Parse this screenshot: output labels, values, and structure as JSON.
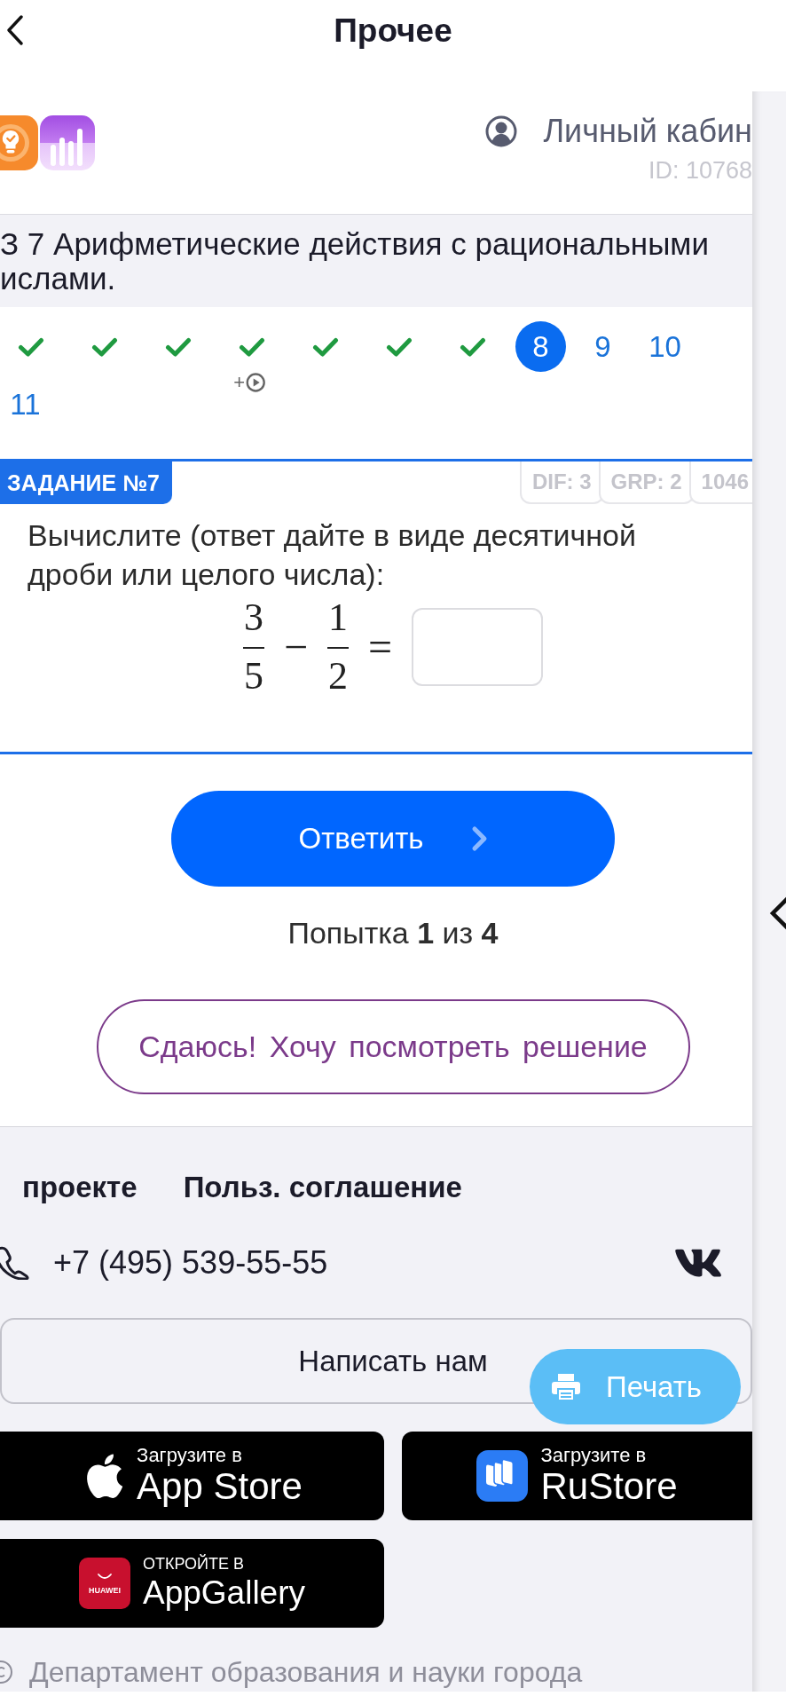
{
  "header": {
    "title": "Прочее"
  },
  "account": {
    "label": "Личный кабин",
    "id": "ID: 10768"
  },
  "lesson": {
    "title": "З 7 Арифметические действия с рациональными\nислами."
  },
  "steps": [
    {
      "done": true,
      "selected": false
    },
    {
      "done": true,
      "selected": false
    },
    {
      "done": true,
      "selected": false
    },
    {
      "done": true,
      "selected": false,
      "bonus": "+"
    },
    {
      "done": true,
      "selected": false
    },
    {
      "done": true,
      "selected": false
    },
    {
      "done": true,
      "selected": false
    },
    {
      "label": "8",
      "done": false,
      "selected": true
    },
    {
      "label": "9",
      "done": false,
      "selected": false
    },
    {
      "label": "10",
      "done": false,
      "selected": false
    },
    {
      "label": "11",
      "done": false,
      "selected": false
    }
  ],
  "task": {
    "badge": "ЗАДАНИЕ №7",
    "tags": [
      "DIF: 3",
      "GRP: 2",
      "1046"
    ],
    "prompt": "Вычислите (ответ дайте в виде десятичной дроби или целого числа):",
    "expression": [
      {
        "kind": "fraction",
        "numerator": "3",
        "denominator": "5"
      },
      {
        "kind": "operator",
        "text": "−"
      },
      {
        "kind": "fraction",
        "numerator": "1",
        "denominator": "2"
      },
      {
        "kind": "operator",
        "text": "="
      },
      {
        "kind": "answer"
      }
    ]
  },
  "submit_button": {
    "label": "Ответить"
  },
  "attempt": {
    "text": "Попытка **1** из **4**"
  },
  "give_up_button": {
    "label": "Сдаюсь! Хочу посмотреть решение"
  },
  "footer": {
    "links": [
      "проекте",
      "Польз. соглашение"
    ],
    "phone": "+7 (495) 539-55-55",
    "contact_button": "Написать нам",
    "print_button": "Печать",
    "stores": [
      {
        "kind": "apple",
        "caption": "Загрузите в",
        "name": "App Store"
      },
      {
        "kind": "rustore",
        "caption": "Загрузите в",
        "name": "RuStore"
      },
      {
        "kind": "huawei",
        "caption": "ОТКРОЙТЕ В",
        "name": "AppGallery",
        "icon_text": "HUAWEI"
      }
    ],
    "copyright": "Департамент образования и науки города"
  }
}
